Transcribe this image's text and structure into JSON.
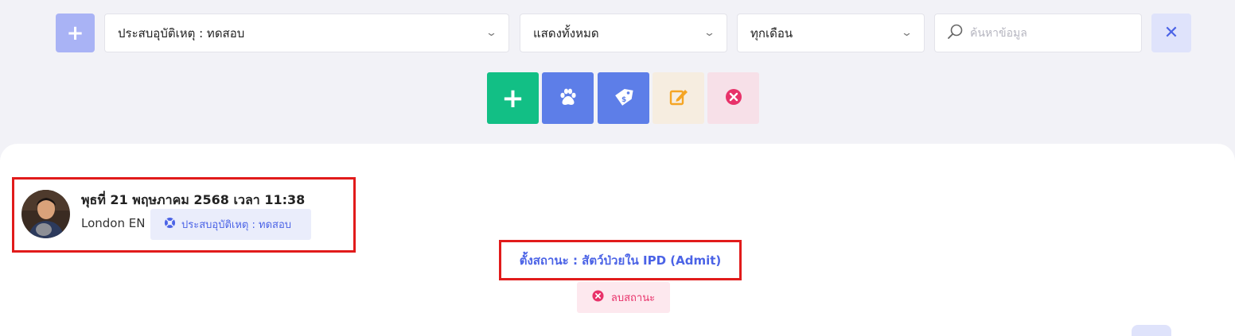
{
  "filters": {
    "category_select": "ประสบอุบัติเหตุ : ทดสอบ",
    "display_select": "แสดงทั้งหมด",
    "month_select": "ทุกเดือน",
    "search_placeholder": "ค้นหาข้อมูล",
    "search_value": ""
  },
  "toolbar": {
    "icons": [
      "plus-icon",
      "paw-icon",
      "tag-icon",
      "edit-icon",
      "close-circle-icon"
    ]
  },
  "entry": {
    "timestamp": "พุธที่ 21 พฤษภาคม 2568 เวลา 11:38",
    "user_name": "London EN",
    "status_badge": "ประสบอุบัติเหตุ : ทดสอบ",
    "status_text": "ตั้งสถานะ : สัตว์ป่วยใน IPD (Admit)",
    "remove_label": "ลบสถานะ"
  },
  "colors": {
    "accent": "#4b63e6",
    "success": "#12bf85",
    "danger": "#e8326a",
    "highlight": "#e11b1b"
  }
}
